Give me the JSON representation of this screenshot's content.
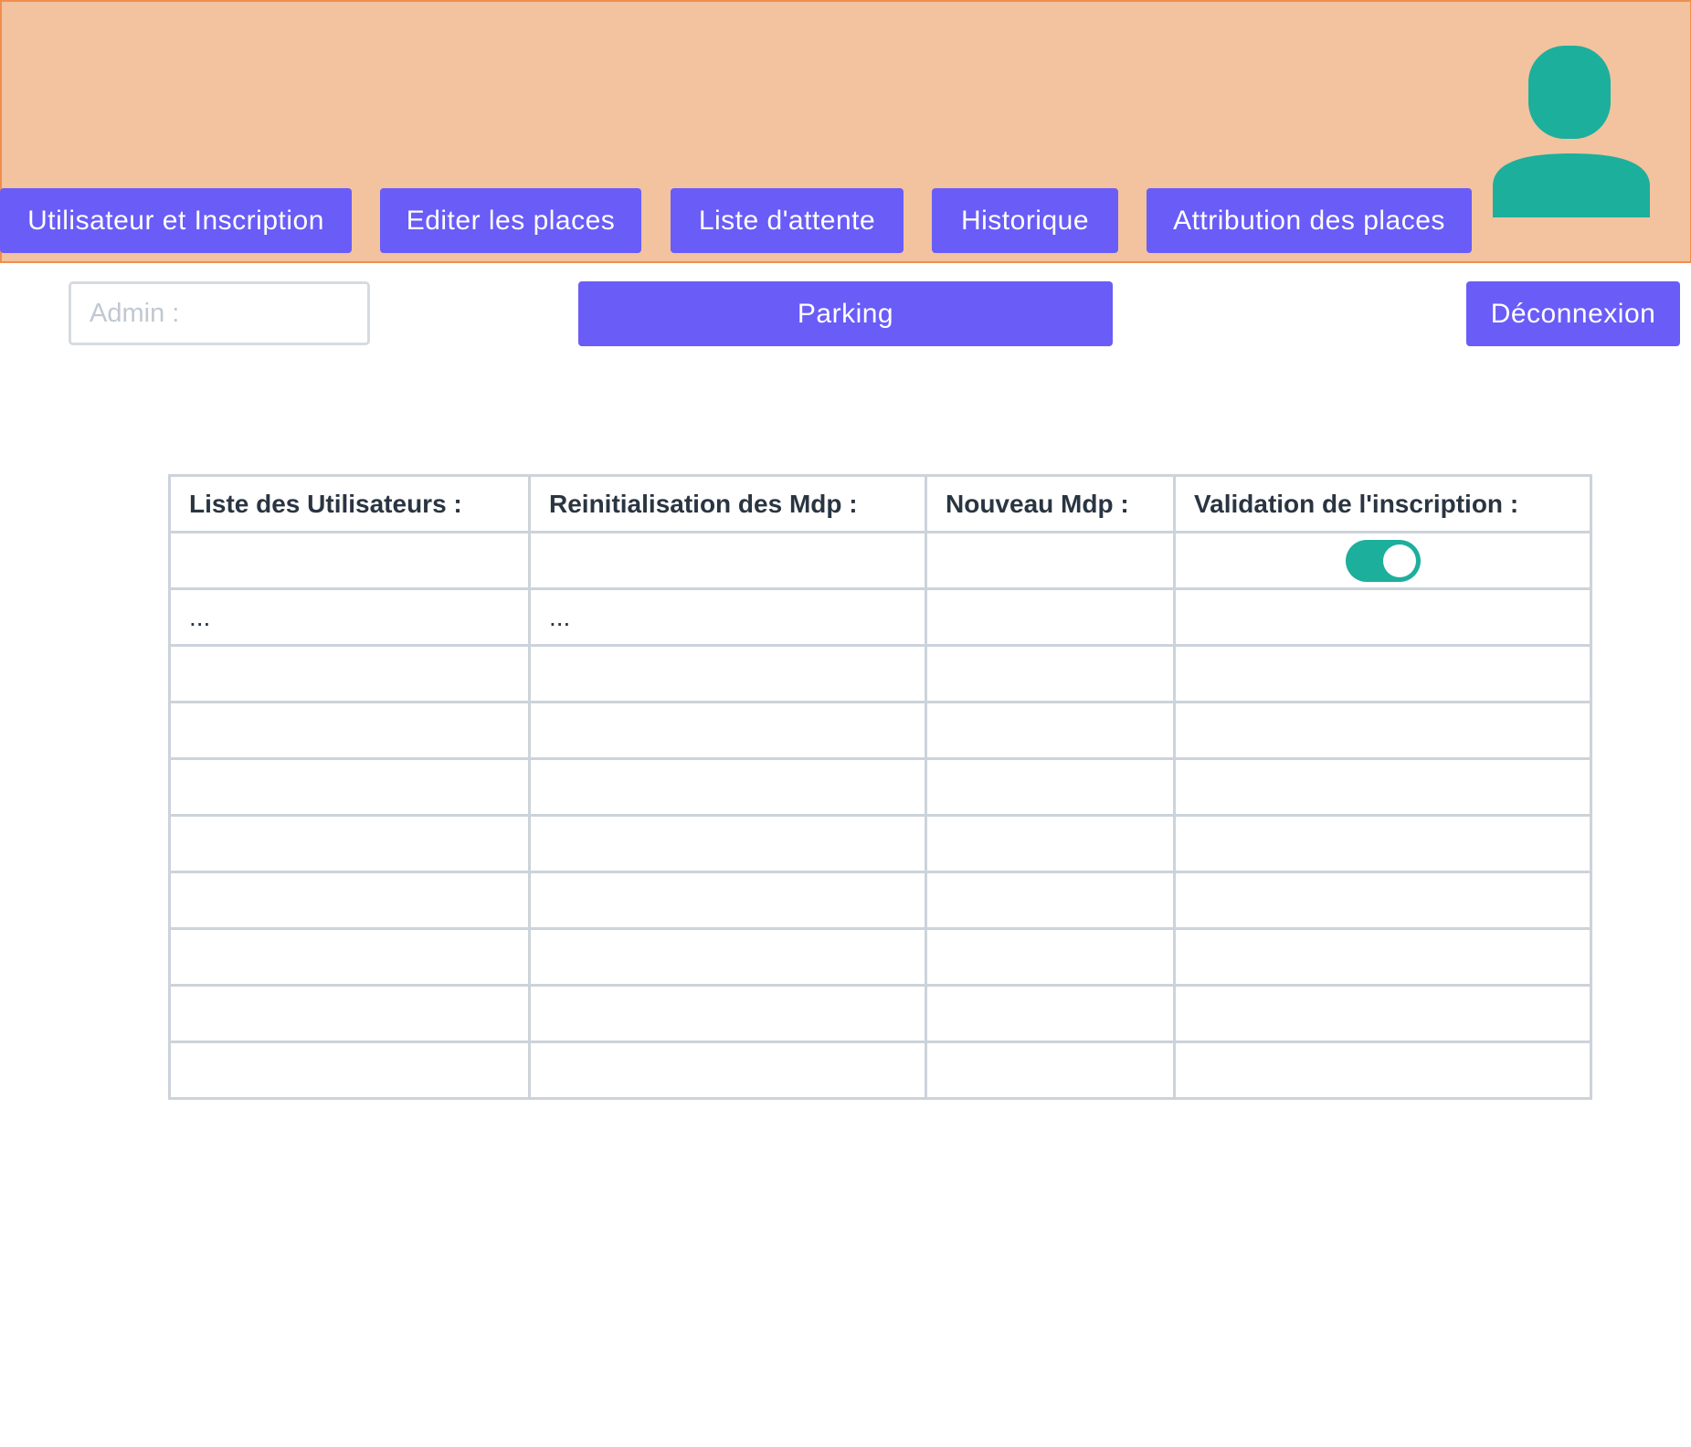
{
  "header": {
    "nav": [
      {
        "label": "Utilisateur et Inscription"
      },
      {
        "label": "Editer les places"
      },
      {
        "label": "Liste d'attente"
      },
      {
        "label": "Historique"
      },
      {
        "label": "Attribution des places"
      }
    ],
    "avatar_icon": "user-avatar-icon"
  },
  "toolbar": {
    "admin_placeholder": "Admin :",
    "admin_value": "",
    "parking_label": "Parking",
    "logout_label": "Déconnexion"
  },
  "table": {
    "columns": [
      "Liste des Utilisateurs :",
      "Reinitialisation des Mdp :",
      "Nouveau Mdp :",
      "Validation de l'inscription :"
    ],
    "rows": [
      [
        "",
        "",
        "",
        ""
      ],
      [
        "...",
        "...",
        "",
        ""
      ],
      [
        "",
        "",
        "",
        ""
      ],
      [
        "",
        "",
        "",
        ""
      ],
      [
        "",
        "",
        "",
        ""
      ],
      [
        "",
        "",
        "",
        ""
      ],
      [
        "",
        "",
        "",
        ""
      ],
      [
        "",
        "",
        "",
        ""
      ],
      [
        "",
        "",
        "",
        ""
      ],
      [
        "",
        "",
        "",
        ""
      ]
    ],
    "validation_toggle": {
      "row": 0,
      "state": "on"
    }
  },
  "colors": {
    "header_bg": "#f3c29f",
    "header_border": "#ef8f4d",
    "button": "#6a5cf7",
    "accent": "#1caf9c",
    "grid": "#ccd3da"
  }
}
